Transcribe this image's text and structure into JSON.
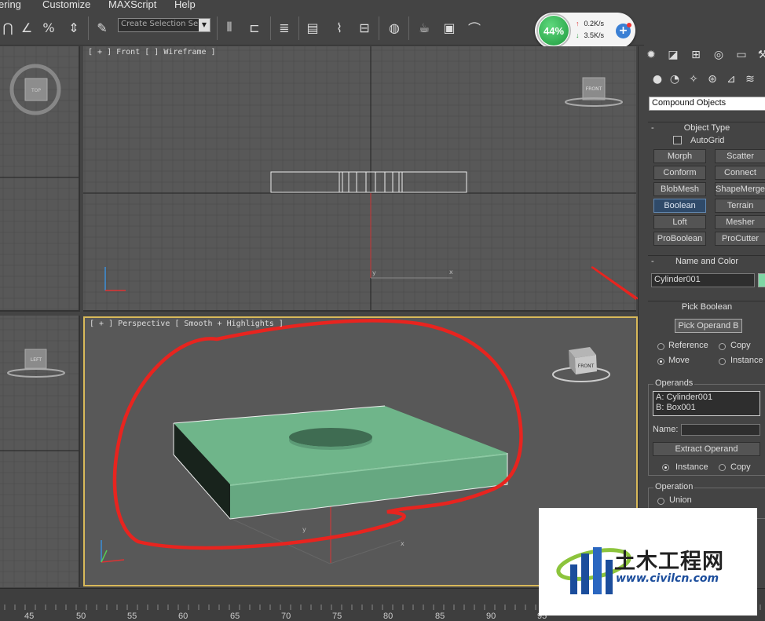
{
  "menu": [
    "ering",
    "Customize",
    "MAXScript",
    "Help"
  ],
  "toolbar": {
    "selection_set_placeholder": "Create Selection Se",
    "icons": [
      "magnet-icon",
      "angle-snap-icon",
      "percent-snap-icon",
      "spinner-snap-icon",
      "edit-named-selection-icon",
      "mirror-icon",
      "align-icon",
      "layer-manager-icon",
      "scene-explorer-icon",
      "curve-editor-icon",
      "schematic-view-icon",
      "material-editor-icon",
      "render-setup-icon",
      "rendered-frame-icon",
      "render-icon"
    ]
  },
  "network": {
    "percent": "44%",
    "upload": "0.2K/s",
    "download": "3.5K/s",
    "colors": {
      "ring": "#2aa84a",
      "plus": "#3a7fd4"
    }
  },
  "viewports": {
    "top": {
      "cube_label": "TOP"
    },
    "front": {
      "label": "[ + ] Front [ ] Wireframe ]",
      "cube_label": "FRONT"
    },
    "left": {
      "cube_label": "LEFT"
    },
    "perspective": {
      "label": "[ + ] Perspective [ Smooth + Highlights ]",
      "cube_label": "FRONT",
      "object_color": "#6fb58a",
      "annotation_color": "#e8241f"
    }
  },
  "ruler": {
    "ticks": [
      "45",
      "50",
      "55",
      "60",
      "65",
      "70",
      "75",
      "80",
      "85",
      "90",
      "95"
    ]
  },
  "panel": {
    "tabs": [
      "create-tab-icon",
      "modify-tab-icon",
      "hierarchy-tab-icon",
      "motion-tab-icon",
      "display-tab-icon",
      "utilities-tab-icon"
    ],
    "subtabs": [
      "geometry-icon",
      "shapes-icon",
      "lights-icon",
      "cameras-icon",
      "helpers-icon",
      "space-warps-icon"
    ],
    "category": "Compound Objects",
    "object_type": {
      "header": "Object Type",
      "autogrid": "AutoGrid",
      "buttons": [
        "Morph",
        "Scatter",
        "Conform",
        "Connect",
        "BlobMesh",
        "ShapeMerge",
        "Boolean",
        "Terrain",
        "Loft",
        "Mesher",
        "ProBoolean",
        "ProCutter"
      ],
      "active": "Boolean"
    },
    "name_color": {
      "header": "Name and Color",
      "name": "Cylinder001",
      "swatch": "#7fd6a4"
    },
    "pick_boolean": {
      "header": "Pick Boolean",
      "button": "Pick Operand B",
      "options": [
        "Reference",
        "Copy",
        "Move",
        "Instance"
      ],
      "selected": "Move"
    },
    "operands": {
      "header": "Operands",
      "items": [
        "A: Cylinder001",
        "B: Box001"
      ],
      "name_label": "Name:",
      "extract_button": "Extract Operand",
      "extract_options": [
        "Instance",
        "Copy"
      ],
      "extract_selected": "Instance"
    },
    "operation": {
      "header": "Operation",
      "first": "Union"
    }
  },
  "watermark": {
    "title": "土木工程网",
    "url": "www.civilcn.com"
  }
}
